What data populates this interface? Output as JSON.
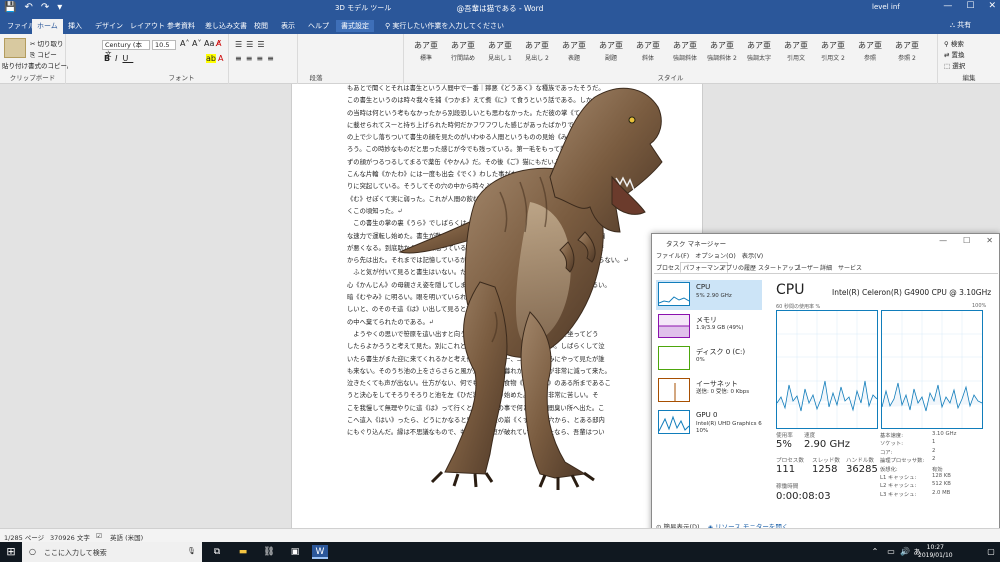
{
  "titlebar": {
    "quick_access": [
      "💾",
      "↶",
      "↷",
      "▾"
    ],
    "doc_title": "@吾輩は猫である - Word",
    "context_group": "3D モデル ツール",
    "user": "level inf",
    "window_buttons": [
      "—",
      "☐",
      "✕"
    ]
  },
  "tabs": [
    "ファイル",
    "ホーム",
    "挿入",
    "デザイン",
    "レイアウト",
    "参考資料",
    "差し込み文書",
    "校閲",
    "表示",
    "ヘルプ",
    "書式設定"
  ],
  "tellme": "実行したい作業を入力してください",
  "share": "共有",
  "ribbon": {
    "paste": "貼り付け",
    "cut": "切り取り",
    "copy": "コピー",
    "format_painter": "書式のコピー/貼り付け",
    "clipboard": "クリップボード",
    "font_name": "Century (本文",
    "font_size": "10.5",
    "font": "フォント",
    "paragraph": "段落",
    "styles_label": "スタイル",
    "styles": [
      {
        "sample": "あア亜",
        "name": "標準"
      },
      {
        "sample": "あア亜",
        "name": "行間詰め"
      },
      {
        "sample": "あア亜",
        "name": "見出し 1"
      },
      {
        "sample": "あア亜",
        "name": "見出し 2"
      },
      {
        "sample": "あア亜",
        "name": "表題"
      },
      {
        "sample": "あア亜",
        "name": "副題"
      },
      {
        "sample": "あア亜",
        "name": "斜体"
      },
      {
        "sample": "あア亜",
        "name": "強調斜体"
      },
      {
        "sample": "あア亜",
        "name": "強調斜体 2"
      },
      {
        "sample": "あア亜",
        "name": "強調太字"
      },
      {
        "sample": "あア亜",
        "name": "引用文"
      },
      {
        "sample": "あア亜",
        "name": "引用文 2"
      },
      {
        "sample": "あア亜",
        "name": "参照"
      },
      {
        "sample": "あア亜",
        "name": "参照 2"
      }
    ],
    "find": "検索",
    "replace": "置換",
    "select": "選択",
    "editing": "編集"
  },
  "document_text": "もあとで聞くとそれは書生という人間中で一番｜獰悪《どうあく》な種族であったそうだ。\nこの書生というのは時々我々を捕《つかま》えて煮《に》て食うという話である。しかしそ\nの当時は何という考もなかったから別段恐しいとも思わなかった。ただ彼の掌《てのひら》\nに載せられてスーと持ち上げられた時何だかフワフワした感じがあったばかりである。掌\nの上で少し落ちついて書生の顔を見たのがいわゆる人間というものの見始《みはじめ》であ\nろう。この時妙なものだと思った感じが今でも残っている。第一毛をもって装飾されべきは\nずの顔がつるつるしてまるで薬缶《やかん》だ。その後《ご》猫にもだいぶ逢《あ》ったが\nこんな片輪《かたわ》には一度も出会《でく》わした事がない。のみならず顔の真中があま\nりに突起している。そうしてその穴の中から時々ぷうぷうと煙《けむり》を吹く。どうも咽\n《む》せぽくて実に弱った。これが人間の飲む煙草《たばこ》というものである事はようや\nくこの頃知った。↵\n　この書生の掌の裏《うら》でしばらくはよい心持に坐っておったが、しばらくすると非常\nな速力で運転し始めた。書生が動くのか自分だけが動くのか分らないが無暗に眼が廻る。胸\nが悪くなる。到底助からないと思っていると、どさりと音がして眼から火が出た。それまで\nから先は出た。それまでは記憶しているがあとは何の事やらいくら考え出そうとしても分らない。↵\n　ふと気が付いて見ると書生はいない。たくさんおった兄弟が一疋も見えぬ。肝\n心《かんじん》の母親さえ姿を隠してしまった。その上今までの所とは違って無暗に明るい。\n暗《むやみ》に明るい。眼を明いていられぬくらいだ。はてな何でも容子がおか\nしいと、のそのそ這《は》い出して見ると非常に痛い。吾輩は藁の上から急に笹原\nの中へ棄てられたのである。↵\n　ようやくの思いで笹原を這い出すと向うに大きな池がある。吾輩は池の前に坐ってどう\nしたらよかろうと考えて見た。別にこれという分別《ふんべつ》も出ない。しばらくして泣\nいたら書生がまた迎に来てくれるかと考え付いた。ニャー、ニャーと試みにやって見たが誰\nも来ない。そのうち池の上をさらさらと風が渡って日が暮れかかる。腹が非常に減って来た。\n泣きたくても声が出ない。仕方がない、何でもよいから食物《くいもの》のある所まであるこ\nうと決心をしてそろりそろりと池を左《ひだ》りに廻り始めた。どうも非常に苦しい。そ\nこを我慢して無理やりに這《は》って行くとようやくの事で何となく人間臭い所へ出た。こ\nこへ這入《はい》ったら、どうにかなると思って竹垣の崩《くず》れた穴から、とある邸内\nにもぐり込んだ。縁は不思議なもので、もしこの竹垣が破れていなかったなら、吾輩はつい",
  "statusbar": {
    "page": "1/285 ページ",
    "words": "370926 文字",
    "language": "英語 (米国)"
  },
  "taskbar": {
    "search_placeholder": "ここに入力して検索",
    "time": "10:27",
    "date": "2019/01/10",
    "ime": "あ"
  },
  "taskmanager": {
    "title": "タスク マネージャー",
    "menu": [
      "ファイル(F)",
      "オプション(O)",
      "表示(V)"
    ],
    "tabs": [
      "プロセス",
      "パフォーマンス",
      "アプリの履歴",
      "スタートアップ",
      "ユーザー",
      "詳細",
      "サービス"
    ],
    "resources": [
      {
        "name": "CPU",
        "value": "5%  2.90 GHz",
        "color": "#117dbb"
      },
      {
        "name": "メモリ",
        "value": "1.9/3.9 GB (49%)",
        "color": "#8b12ae"
      },
      {
        "name": "ディスク 0 (C:)",
        "value": "0%",
        "color": "#4da60c"
      },
      {
        "name": "イーサネット",
        "value": "送信: 0 受信: 0 Kbps",
        "color": "#a74f01"
      },
      {
        "name": "GPU 0",
        "value": "Intel(R) UHD Graphics 6\n10%",
        "color": "#117dbb"
      }
    ],
    "cpu_heading": "CPU",
    "cpu_model": "Intel(R) Celeron(R) G4900 CPU @ 3.10GHz",
    "graph_label": "60 秒間の使用率 %",
    "graph_max": "100%",
    "stats": {
      "util_label": "使用率",
      "util_value": "5%",
      "speed_label": "速度",
      "speed_value": "2.90 GHz",
      "proc_label": "プロセス数",
      "proc_value": "111",
      "thread_label": "スレッド数",
      "thread_value": "1258",
      "handle_label": "ハンドル数",
      "handle_value": "36285",
      "uptime_label": "稼働時間",
      "uptime_value": "0:00:08:03"
    },
    "specs": [
      {
        "k": "基本速度:",
        "v": "3.10 GHz"
      },
      {
        "k": "ソケット:",
        "v": "1"
      },
      {
        "k": "コア:",
        "v": "2"
      },
      {
        "k": "論理プロセッサ数:",
        "v": "2"
      },
      {
        "k": "仮想化:",
        "v": "有効"
      },
      {
        "k": "L1 キャッシュ:",
        "v": "128 KB"
      },
      {
        "k": "L2 キャッシュ:",
        "v": "512 KB"
      },
      {
        "k": "L3 キャッシュ:",
        "v": "2.0 MB"
      }
    ],
    "fewer_details": "簡易表示(D)",
    "resource_monitor": "リソース モニターを開く"
  }
}
